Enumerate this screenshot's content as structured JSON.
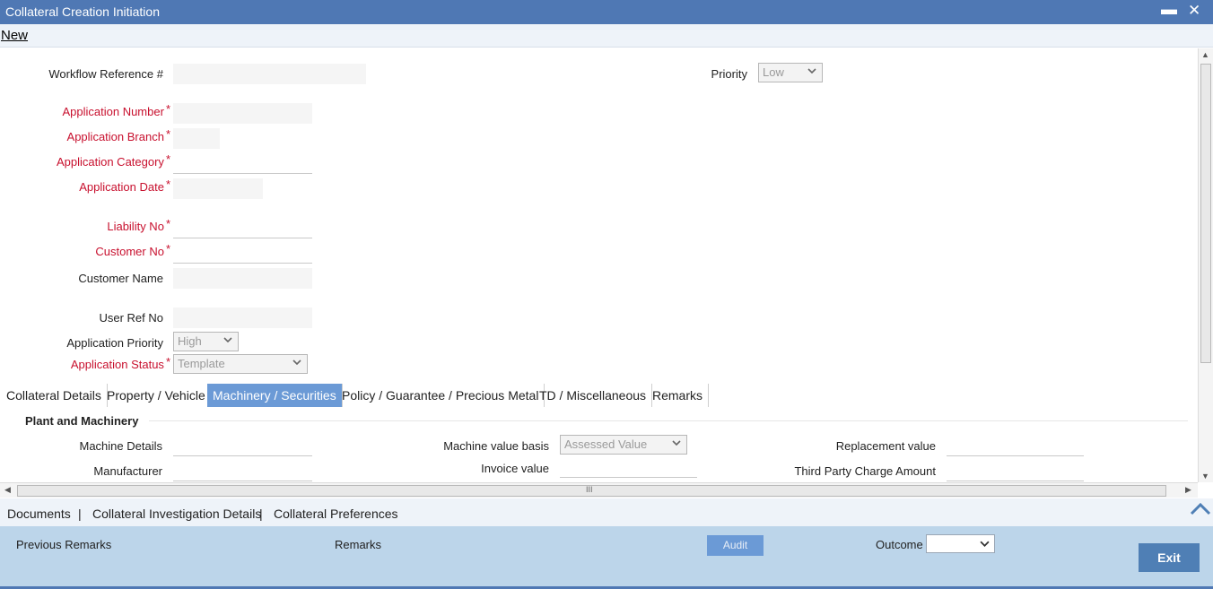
{
  "window": {
    "title": "Collateral Creation Initiation",
    "minimize_glyph": "▬",
    "close_glyph": "✕"
  },
  "menu": {
    "new_label": "New"
  },
  "form": {
    "workflow_ref": {
      "label": "Workflow Reference #",
      "value": ""
    },
    "priority": {
      "label": "Priority",
      "value": "Low"
    },
    "application_number": {
      "label": "Application Number",
      "required": true,
      "value": ""
    },
    "application_branch": {
      "label": "Application Branch",
      "required": true,
      "value": ""
    },
    "application_category": {
      "label": "Application Category",
      "required": true,
      "value": ""
    },
    "application_date": {
      "label": "Application Date",
      "required": true,
      "value": ""
    },
    "liability_no": {
      "label": "Liability No",
      "required": true,
      "value": ""
    },
    "customer_no": {
      "label": "Customer No",
      "required": true,
      "value": ""
    },
    "customer_name": {
      "label": "Customer Name",
      "value": ""
    },
    "user_ref_no": {
      "label": "User Ref No",
      "value": ""
    },
    "application_priority": {
      "label": "Application Priority",
      "value": "High"
    },
    "application_status": {
      "label": "Application Status",
      "required": true,
      "value": "Template"
    },
    "required_marker": "*"
  },
  "tabs": [
    {
      "label": "Collateral Details",
      "active": false
    },
    {
      "label": "Property / Vehicle",
      "active": false
    },
    {
      "label": "Machinery / Securities",
      "active": true
    },
    {
      "label": "Policy / Guarantee / Precious Metal",
      "active": false
    },
    {
      "label": "TD / Miscellaneous",
      "active": false
    },
    {
      "label": "Remarks",
      "active": false
    }
  ],
  "machinery": {
    "section_title": "Plant and Machinery",
    "machine_details": {
      "label": "Machine Details",
      "value": ""
    },
    "manufacturer": {
      "label": "Manufacturer",
      "value": ""
    },
    "machine_value_basis": {
      "label": "Machine value basis",
      "value": "Assessed Value"
    },
    "invoice_value": {
      "label": "Invoice value",
      "value": ""
    },
    "replacement_value": {
      "label": "Replacement value",
      "value": ""
    },
    "third_party_charge": {
      "label": "Third Party Charge Amount",
      "value": ""
    }
  },
  "scroll": {
    "grip_glyph": "III",
    "left_glyph": "◀",
    "right_glyph": "▶",
    "up_glyph": "▲",
    "down_glyph": "▼"
  },
  "links": {
    "documents": "Documents",
    "investigation": "Collateral Investigation Details",
    "preferences": "Collateral Preferences",
    "separator": "|"
  },
  "footer": {
    "previous_remarks": "Previous Remarks",
    "remarks": "Remarks",
    "audit": "Audit",
    "outcome": "Outcome",
    "outcome_value": "",
    "exit": "Exit"
  },
  "colors": {
    "titlebar": "#4f78b4",
    "required": "#c8102e",
    "active_tab": "#6b9ad6",
    "footer": "#bcd5ea",
    "exit_button": "#4f7fb5"
  }
}
